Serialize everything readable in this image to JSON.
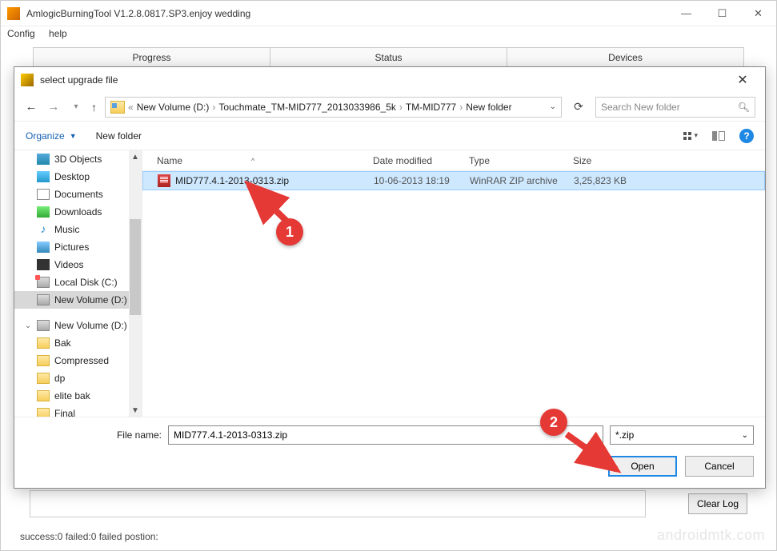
{
  "parent": {
    "title": "AmlogicBurningTool  V1.2.8.0817.SP3.enjoy wedding",
    "menu": {
      "config": "Config",
      "help": "help"
    },
    "tabs": {
      "progress": "Progress",
      "status": "Status",
      "devices": "Devices"
    },
    "status_text": "success:0 failed:0 failed postion:",
    "clear_log": "Clear Log"
  },
  "watermark": "androidmtk.com",
  "dialog": {
    "title": "select upgrade file",
    "breadcrumb": {
      "prefix": "«",
      "p1": "New Volume (D:)",
      "p2": "Touchmate_TM-MID777_2013033986_5k",
      "p3": "TM-MID777",
      "p4": "New folder"
    },
    "search_placeholder": "Search New folder",
    "toolbar": {
      "organize": "Organize",
      "new_folder": "New folder"
    },
    "columns": {
      "name": "Name",
      "date": "Date modified",
      "type": "Type",
      "size": "Size"
    },
    "sidebar": {
      "items": [
        "3D Objects",
        "Desktop",
        "Documents",
        "Downloads",
        "Music",
        "Pictures",
        "Videos",
        "Local Disk (C:)",
        "New Volume (D:)"
      ],
      "root": "New Volume (D:)",
      "subs": [
        "Bak",
        "Compressed",
        "dp",
        "elite bak",
        "Final"
      ]
    },
    "file": {
      "name": "MID777.4.1-2013-0313.zip",
      "date": "10-06-2013 18:19",
      "type": "WinRAR ZIP archive",
      "size": "3,25,823 KB"
    },
    "filename_label": "File name:",
    "filename_value": "MID777.4.1-2013-0313.zip",
    "filter": "*.zip",
    "open": "Open",
    "cancel": "Cancel"
  },
  "annotations": {
    "one": "1",
    "two": "2"
  }
}
